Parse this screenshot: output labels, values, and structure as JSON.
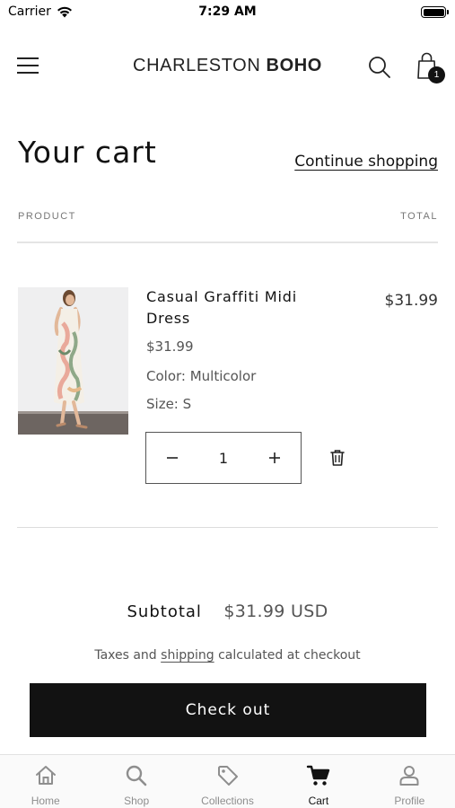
{
  "status_bar": {
    "carrier": "Carrier",
    "time": "7:29 AM"
  },
  "header": {
    "logo_regular": "CHARLESTON",
    "logo_bold": "BOHO",
    "cart_count": "1"
  },
  "page": {
    "title": "Your cart",
    "continue_shopping": "Continue shopping"
  },
  "table": {
    "col_product": "PRODUCT",
    "col_total": "TOTAL"
  },
  "item": {
    "name": "Casual Graffiti Midi Dress",
    "price": "$31.99",
    "color": "Color: Multicolor",
    "size": "Size: S",
    "quantity": "1",
    "total": "$31.99"
  },
  "summary": {
    "subtotal_label": "Subtotal",
    "subtotal_value": "$31.99 USD",
    "tax_before": "Taxes and ",
    "tax_link": "shipping",
    "tax_after": " calculated at checkout",
    "checkout_label": "Check out"
  },
  "tabs": [
    {
      "label": "Home",
      "icon": "home-icon"
    },
    {
      "label": "Shop",
      "icon": "search-icon"
    },
    {
      "label": "Collections",
      "icon": "tag-icon"
    },
    {
      "label": "Cart",
      "icon": "cart-icon"
    },
    {
      "label": "Profile",
      "icon": "profile-icon"
    }
  ],
  "colors": {
    "accent": "#121212",
    "active_tab": "#121212",
    "inactive_tab": "#8e8e8e"
  }
}
